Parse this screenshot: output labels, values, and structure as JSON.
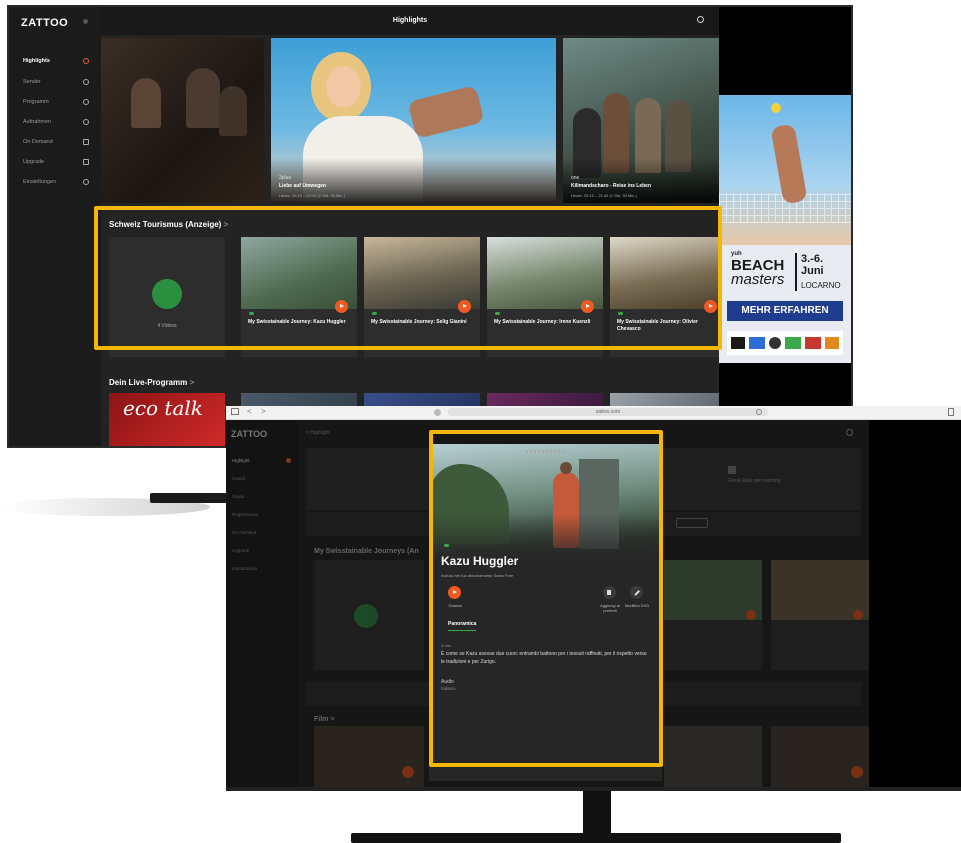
{
  "desktop_app": {
    "logo": "ZATTOO",
    "page_title": "Highlights",
    "sidebar": [
      {
        "label": "Highlights",
        "active": true
      },
      {
        "label": "Sender"
      },
      {
        "label": "Programm"
      },
      {
        "label": "Aufnahmen"
      },
      {
        "label": "On Demand"
      },
      {
        "label": "Upgrade"
      },
      {
        "label": "Einstellungen"
      }
    ],
    "hero": [
      {
        "channel": "",
        "title": "",
        "meta": ""
      },
      {
        "channel": "3plus",
        "title": "Liebe auf Umwegen",
        "meta": "Heute, 20:15 – 22:10 (2 Std. 35 Min.)"
      },
      {
        "channel": "one",
        "title": "Kilimandscharo - Reise ins Leben",
        "meta": "Heute, 20:15 – 21:45 (1 Std. 30 Min.)"
      }
    ],
    "section1": {
      "title": "Schweiz Tourismus (Anzeige)",
      "chevron": ">",
      "folder_label": "4 Videos",
      "cards": [
        {
          "title": "My Swisstainable Journey: Kazu Huggler"
        },
        {
          "title": "My Swisstainable Journey: Selig Gianini"
        },
        {
          "title": "My Swisstainable Journey: Irene Kuenzli"
        },
        {
          "title": "My Swisstainable Journey: Olivier Chevasco"
        }
      ]
    },
    "section2": {
      "title": "Dein Live-Programm",
      "chevron": ">",
      "tile_text": "eco talk"
    },
    "ad": {
      "brand": "yuh",
      "event_line1": "BEACH",
      "event_line2": "masters",
      "date": "3.-6. Juni",
      "city": "LOCARNO",
      "cta": "MEHR ERFAHREN"
    }
  },
  "browser": {
    "url": "zattoo.com",
    "nav_back": "<",
    "nav_forward": ">"
  },
  "front_app": {
    "logo": "ZATTOO",
    "breadcrumb": "< Highlight",
    "section_title": "My Swisstainable Journeys (An",
    "film_title": "Film >",
    "ad_caption": "Great Rate per roaming",
    "modal": {
      "title": "Kazu Huggler",
      "subtitle": "Incluso nel tuo abbonamento Swiss Free",
      "actions": [
        {
          "label": "Guarda"
        },
        {
          "label": "Aggiungi ai preferiti"
        },
        {
          "label": "Modifica DVD"
        }
      ],
      "tab": "Panoramica",
      "duration": "4 min",
      "description": "È come se Kazu avesse due cuori: entrambi battono per i tessuti raffinati, per il rispetto verso le tradizioni e per Zurigo.",
      "audio_label": "Audio",
      "audio_value": "Italiano"
    }
  },
  "colors": {
    "accent": "#f05a22",
    "highlight_frame": "#f5b800",
    "green": "#3da84a"
  }
}
